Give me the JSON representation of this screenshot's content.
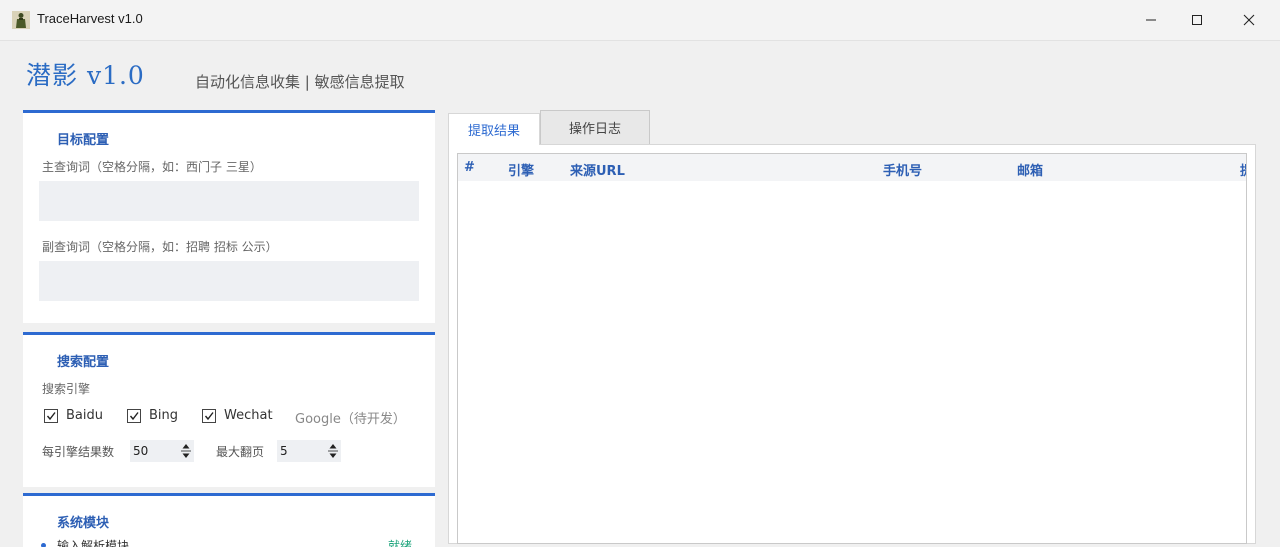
{
  "window": {
    "title": "TraceHarvest v1.0"
  },
  "header": {
    "app_name": "潜影  v1.0",
    "subtitle": "自动化信息收集 | 敏感信息提取"
  },
  "target_config": {
    "title": "目标配置",
    "primary_query_label": "主查询词（空格分隔，如：西门子 三星）",
    "primary_query_value": "",
    "secondary_query_label": "副查询词（空格分隔，如：招聘 招标 公示）",
    "secondary_query_value": ""
  },
  "search_config": {
    "title": "搜索配置",
    "engines_label": "搜索引擎",
    "engines": [
      {
        "label": "Baidu",
        "checked": true
      },
      {
        "label": "Bing",
        "checked": true
      },
      {
        "label": "Wechat",
        "checked": true
      }
    ],
    "google_label": "Google（待开发）",
    "results_per_engine_label": "每引擎结果数",
    "results_per_engine": "50",
    "max_pages_label": "最大翻页",
    "max_pages": "5"
  },
  "system_modules": {
    "title": "系统模块",
    "items": [
      {
        "name": "输入解析模块",
        "status": "就绪"
      }
    ]
  },
  "tabs": [
    {
      "label": "提取结果",
      "active": true
    },
    {
      "label": "操作日志",
      "active": false
    }
  ],
  "results_table": {
    "columns": [
      "#",
      "引擎",
      "来源URL",
      "手机号",
      "邮箱",
      "提"
    ],
    "rows": []
  },
  "colors": {
    "accent": "#2d6ad1",
    "header_text": "#2d5fb4",
    "ready_status": "#1aa37a",
    "input_bg": "#eef0f3"
  },
  "icons": {
    "app": "soldier-icon",
    "minimize": "minimize-icon",
    "maximize": "maximize-icon",
    "close": "close-icon",
    "checkbox": "checkmark-icon",
    "spinner": "spinner-arrows-icon"
  }
}
